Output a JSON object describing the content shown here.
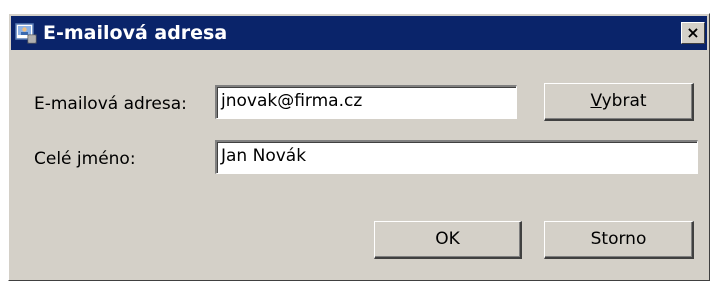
{
  "window": {
    "title": "E-mailová adresa",
    "close_label": "×"
  },
  "form": {
    "email_label": "E-mailová adresa:",
    "email_value": "jnovak@firma.cz",
    "name_label": "Celé jméno:",
    "name_value": "Jan Novák"
  },
  "buttons": {
    "select_accel": "V",
    "select_rest": "ybrat",
    "ok_label": "OK",
    "cancel_label": "Storno"
  },
  "icons": {
    "title_icon": "address-book-icon"
  },
  "colors": {
    "titlebar": "#0a246a",
    "face": "#d4d0c8"
  }
}
